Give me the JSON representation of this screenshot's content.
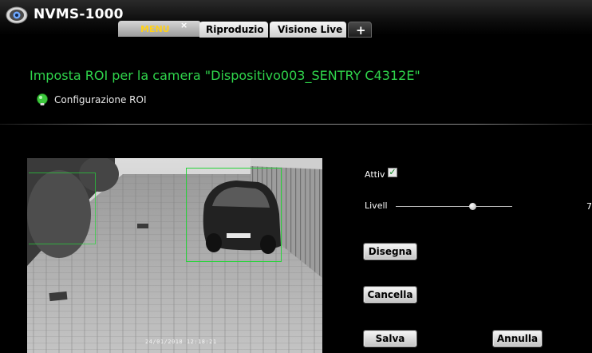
{
  "app": {
    "title": "NVMS-1000"
  },
  "tabs": [
    {
      "label": "MENU",
      "active": true,
      "close": "×"
    },
    {
      "label": "Riproduzio"
    },
    {
      "label": "Visione Live"
    },
    {
      "label": "+"
    }
  ],
  "page": {
    "title": "Imposta ROI per la camera \"Dispositivo003_SENTRY C4312E\"",
    "subtitle": "Configurazione ROI"
  },
  "preview": {
    "timestamp": "24/01/2018 12:18:21"
  },
  "controls": {
    "attiv_label": "Attiv",
    "attiv_checked": true,
    "attiv_mark": "✓",
    "livell_label": "Livell",
    "livell_value": "7",
    "livell_fraction": 0.66
  },
  "buttons": {
    "disegna": "Disegna",
    "cancella": "Cancella",
    "salva": "Salva",
    "annulla": "Annulla"
  },
  "colors": {
    "accent_green": "#2fd44b",
    "roi_green": "#27d43a",
    "active_tab_text": "#ffd21a",
    "background": "#000000"
  },
  "icons": {
    "logo": "camera-lens-icon",
    "subtitle": "green-bulb-icon"
  }
}
